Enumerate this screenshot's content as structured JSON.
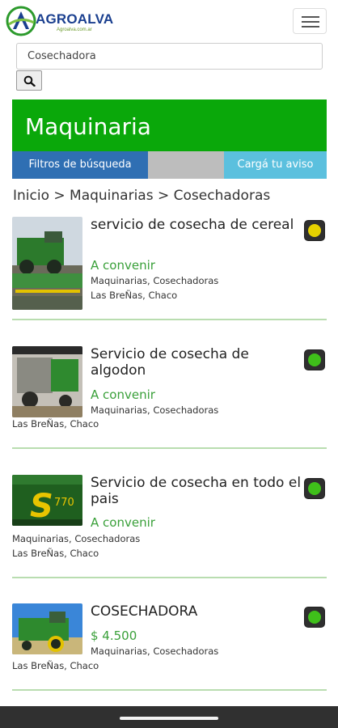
{
  "header": {
    "brand": "AGROALVA",
    "tagline": "Agroalva.com.ar",
    "logo_icon": "agroalva-logo-icon",
    "menu_icon": "hamburger-menu-icon"
  },
  "search": {
    "value": "Cosechadora",
    "button_icon": "search-icon"
  },
  "hero": {
    "title": "Maquinaria",
    "filters_label": "Filtros de búsqueda",
    "post_ad_label": "Cargá tu aviso"
  },
  "breadcrumb": "Inicio > Maquinarias > Cosechadoras",
  "listings": [
    {
      "title": "servicio de cosecha de cereal",
      "price": "A convenir",
      "categories": "Maquinarias, Cosechadoras",
      "location": "Las BreÑas, Chaco",
      "status_color": "#e6d200"
    },
    {
      "title": "Servicio de cosecha de algodon",
      "price": "A convenir",
      "categories": "Maquinarias, Cosechadoras",
      "location": "Las BreÑas, Chaco",
      "status_color": "#3fc01a"
    },
    {
      "title": "Servicio de cosecha en todo el pais",
      "price": "A convenir",
      "categories": "Maquinarias, Cosechadoras",
      "location": "Las BreÑas, Chaco",
      "status_color": "#3fc01a"
    },
    {
      "title": "COSECHADORA",
      "price": "$ 4.500",
      "categories": "Maquinarias, Cosechadoras",
      "location": "Las BreÑas, Chaco",
      "status_color": "#3fc01a"
    }
  ],
  "colors": {
    "brand_green": "#0aa80a",
    "filters_blue": "#2f6fb3",
    "post_ad_cyan": "#5bc0de",
    "price_green": "#3aa03a"
  }
}
